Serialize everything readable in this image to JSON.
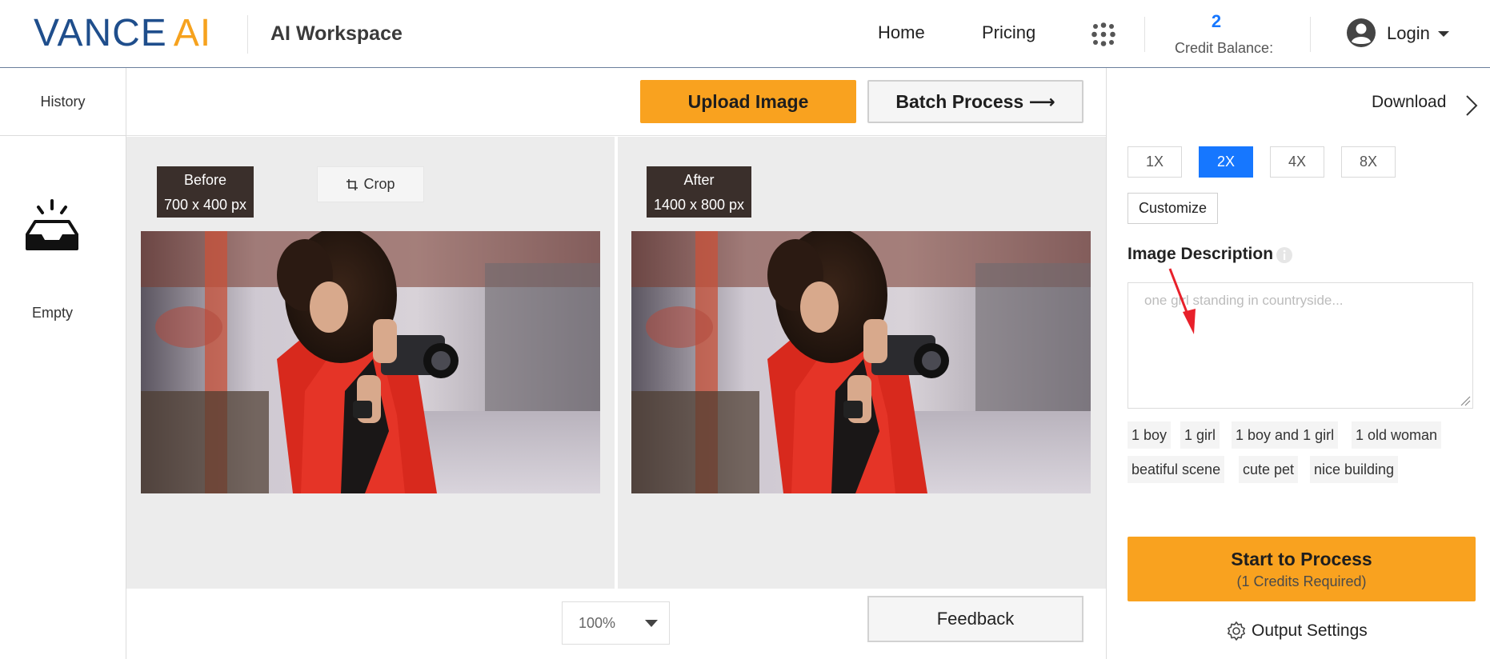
{
  "header": {
    "logo_vance": "VANCE",
    "logo_ai": "AI",
    "workspace": "AI Workspace",
    "nav_home": "Home",
    "nav_pricing": "Pricing",
    "credit_balance_value": "2",
    "credit_balance_label": "Credit Balance:",
    "login": "Login"
  },
  "sidebar": {
    "history": "History",
    "empty": "Empty"
  },
  "toolbar": {
    "upload_label": "Upload Image",
    "batch_label": "Batch Process ⟶"
  },
  "preview": {
    "before_label": "Before",
    "before_size": "700 x 400 px",
    "after_label": "After",
    "after_size": "1400 x 800 px",
    "crop_label": "Crop"
  },
  "bottom": {
    "zoom_value": "100%",
    "feedback_label": "Feedback"
  },
  "panel": {
    "download_label": "Download",
    "scales": [
      "1X",
      "2X",
      "4X",
      "8X"
    ],
    "active_scale": "2X",
    "customize_label": "Customize",
    "description_title": "Image Description",
    "description_placeholder": "one girl standing in countryside...",
    "tags": [
      "1 boy",
      "1 girl",
      "1 boy and 1 girl",
      "1 old woman",
      "beatiful scene",
      "cute pet",
      "nice building"
    ],
    "process_label": "Start to Process",
    "process_sub": "(1 Credits Required)",
    "output_settings_label": "Output Settings"
  },
  "colors": {
    "brand_blue": "#1f4e8c",
    "brand_orange": "#f6a21e",
    "accent_blue": "#1677ff",
    "badge_bg": "#3a2f2b"
  }
}
